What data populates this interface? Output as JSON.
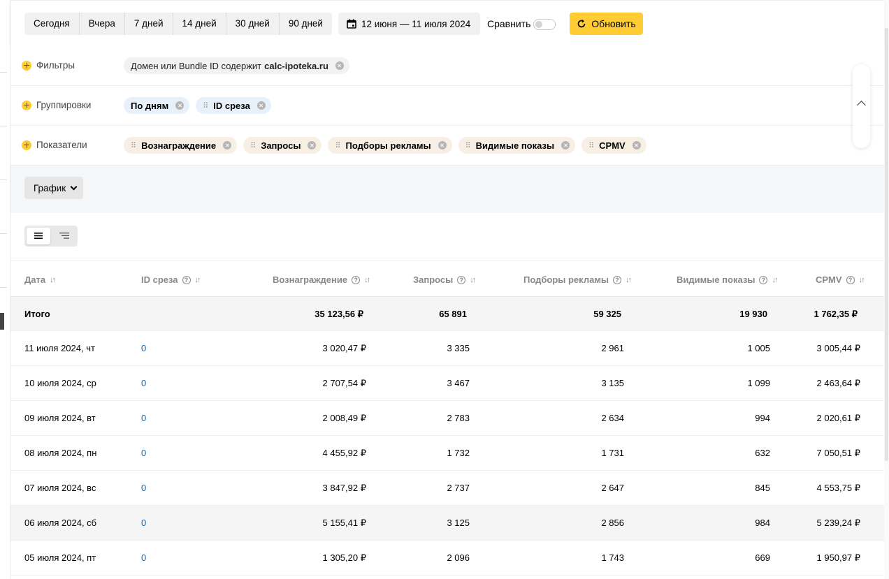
{
  "toolbar": {
    "periods": [
      "Сегодня",
      "Вчера",
      "7 дней",
      "14 дней",
      "30 дней",
      "90 дней"
    ],
    "date_range": "12 июня — 11 июля 2024",
    "compare_label": "Сравнить",
    "refresh_label": "Обновить"
  },
  "filters": {
    "label": "Фильтры",
    "chip_prefix": "Домен или Bundle ID содержит",
    "chip_value": "calc-ipoteka.ru"
  },
  "groupings": {
    "label": "Группировки",
    "chips": [
      "По дням",
      "ID среза"
    ]
  },
  "metrics": {
    "label": "Показатели",
    "chips": [
      "Вознаграждение",
      "Запросы",
      "Подборы рекламы",
      "Видимые показы",
      "CPMV"
    ]
  },
  "chart_toggle": {
    "label": "График"
  },
  "table": {
    "headers": [
      "Дата",
      "ID среза",
      "Вознаграждение",
      "Запросы",
      "Подборы рекламы",
      "Видимые показы",
      "CPMV"
    ],
    "total": {
      "label": "Итого",
      "reward": "35 123,56 ₽",
      "requests": "65 891",
      "ad_selections": "59 325",
      "visible_impressions": "19 930",
      "cpmv": "1 762,35 ₽"
    },
    "rows": [
      {
        "date": "11 июля 2024, чт",
        "slice": "0",
        "reward": "3 020,47 ₽",
        "requests": "3 335",
        "ad_selections": "2 961",
        "visible_impressions": "1 005",
        "cpmv": "3 005,44 ₽"
      },
      {
        "date": "10 июля 2024, ср",
        "slice": "0",
        "reward": "2 707,54 ₽",
        "requests": "3 467",
        "ad_selections": "3 135",
        "visible_impressions": "1 099",
        "cpmv": "2 463,64 ₽"
      },
      {
        "date": "09 июля 2024, вт",
        "slice": "0",
        "reward": "2 008,49 ₽",
        "requests": "2 783",
        "ad_selections": "2 634",
        "visible_impressions": "994",
        "cpmv": "2 020,61 ₽"
      },
      {
        "date": "08 июля 2024, пн",
        "slice": "0",
        "reward": "4 455,92 ₽",
        "requests": "1 732",
        "ad_selections": "1 731",
        "visible_impressions": "632",
        "cpmv": "7 050,51 ₽"
      },
      {
        "date": "07 июля 2024, вс",
        "slice": "0",
        "reward": "3 847,92 ₽",
        "requests": "2 737",
        "ad_selections": "2 647",
        "visible_impressions": "845",
        "cpmv": "4 553,75 ₽"
      },
      {
        "date": "06 июля 2024, сб",
        "slice": "0",
        "reward": "5 155,41 ₽",
        "requests": "3 125",
        "ad_selections": "2 856",
        "visible_impressions": "984",
        "cpmv": "5 239,24 ₽"
      },
      {
        "date": "05 июля 2024, пт",
        "slice": "0",
        "reward": "1 305,20 ₽",
        "requests": "2 096",
        "ad_selections": "1 743",
        "visible_impressions": "669",
        "cpmv": "1 950,97 ₽"
      }
    ]
  },
  "colors": {
    "accent": "#ffcc33",
    "link": "#1a5fa6",
    "group_chip": "#e8f1fa",
    "metric_chip": "#f7efe4"
  }
}
